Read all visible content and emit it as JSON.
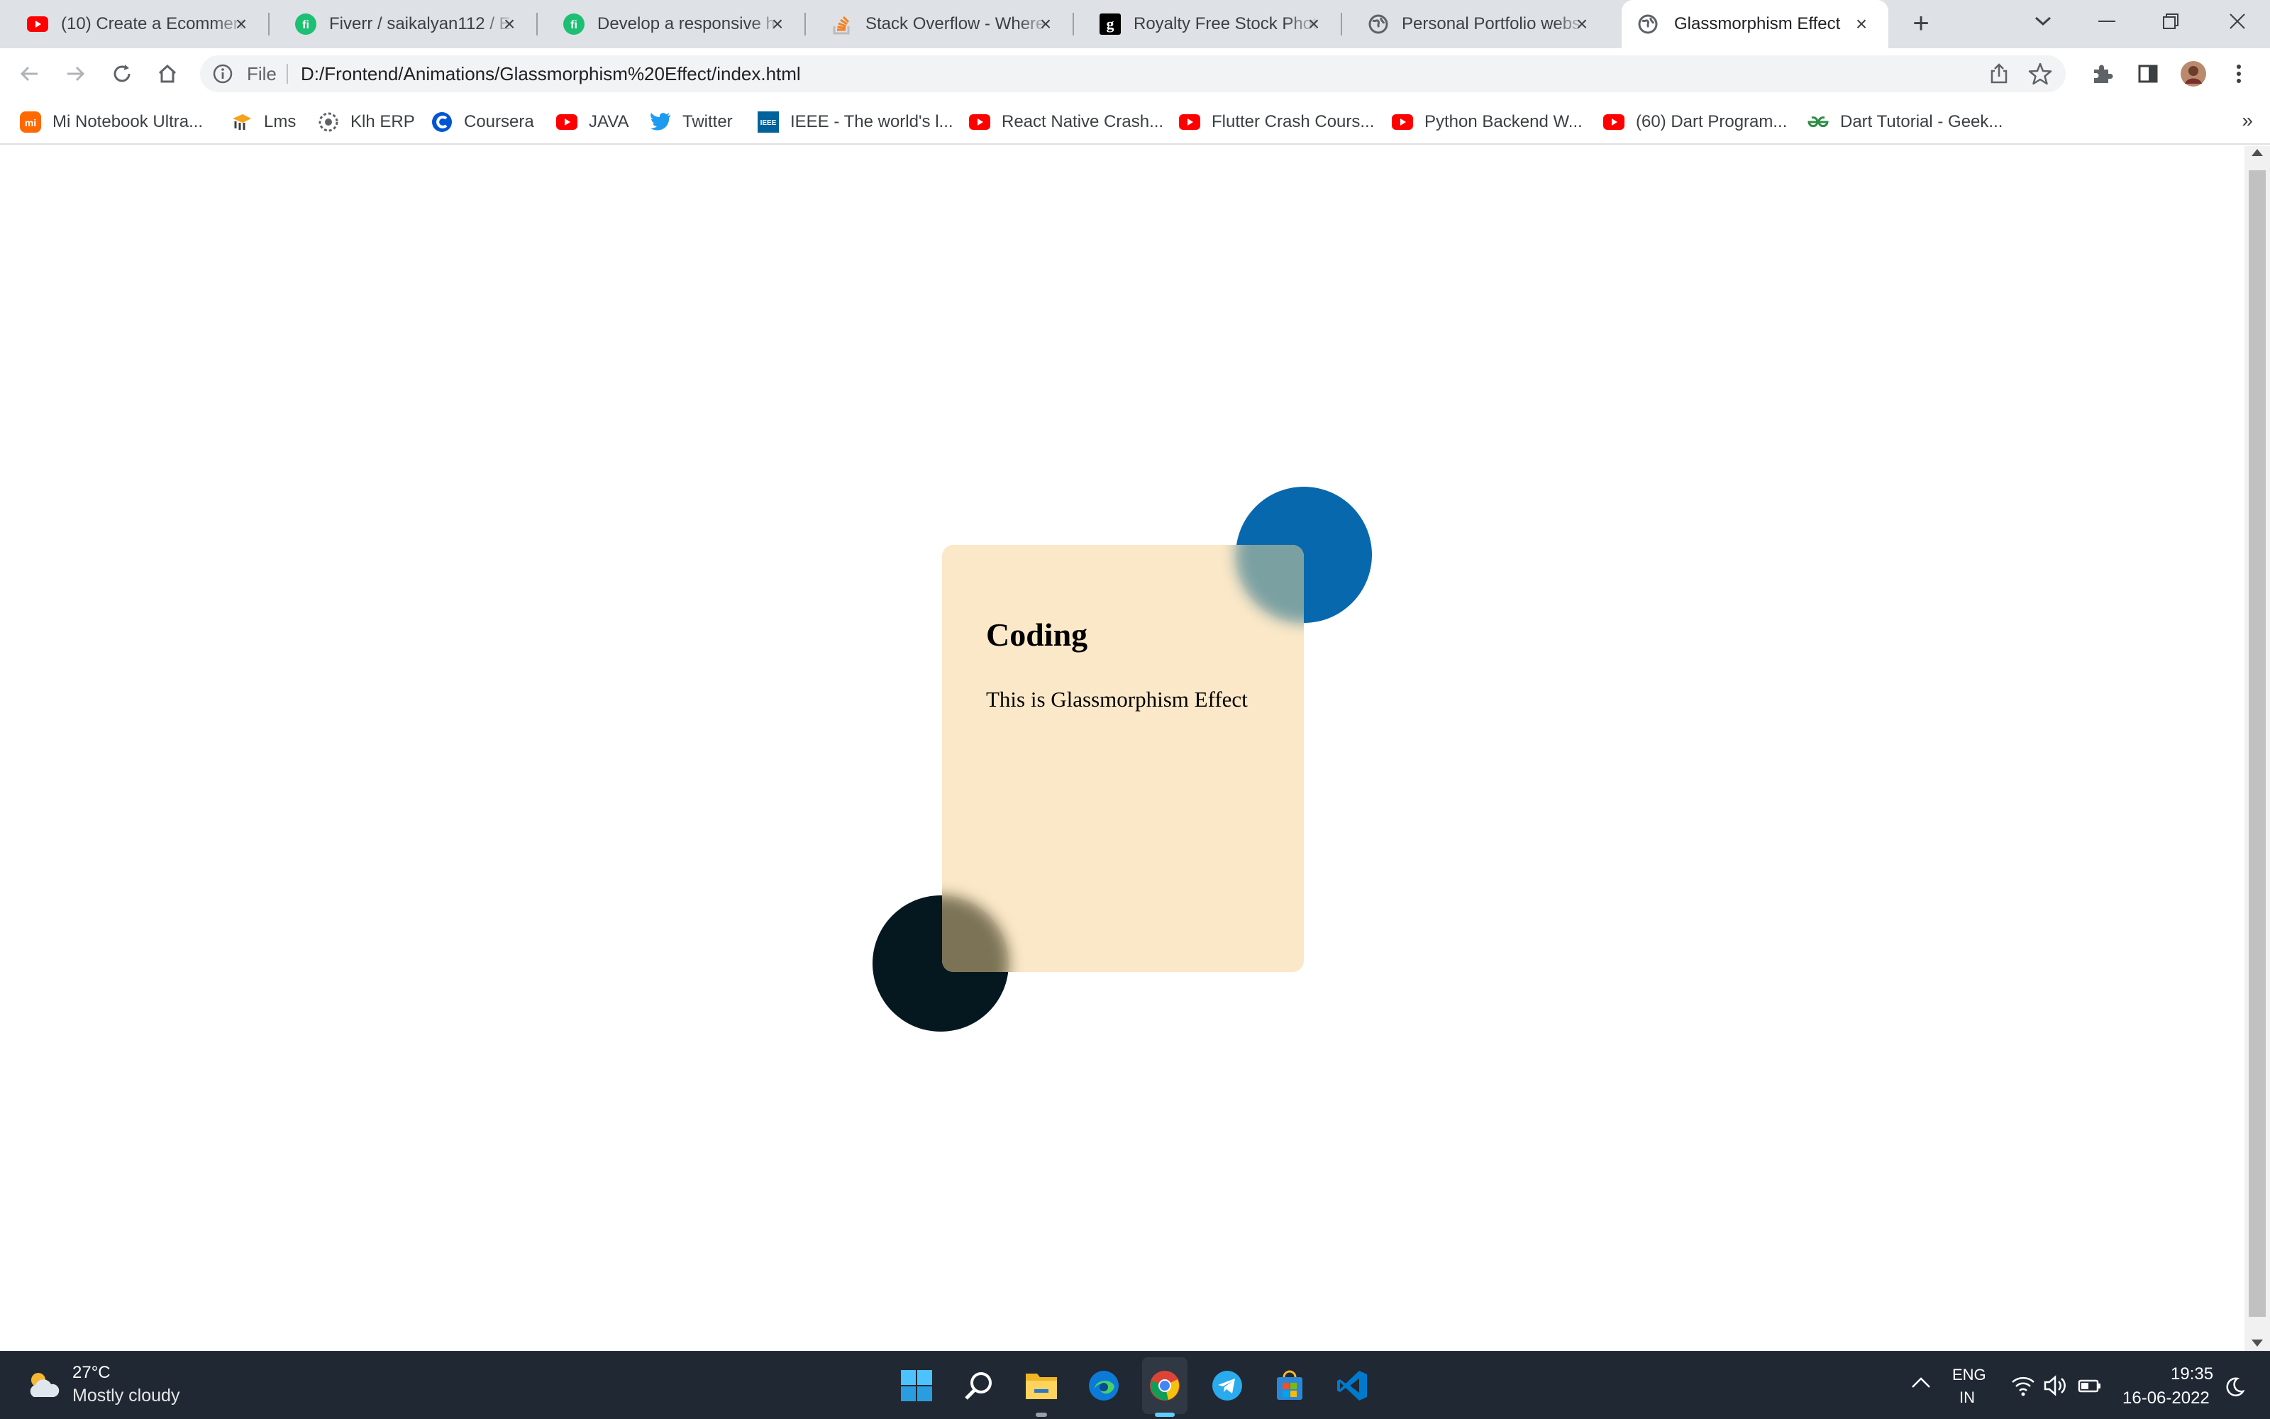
{
  "browser": {
    "tabs": [
      {
        "title": "(10) Create a Ecommerce",
        "favicon": "youtube-icon",
        "active": false
      },
      {
        "title": "Fiverr / saikalyan112 / E",
        "favicon": "fiverr-icon",
        "active": false
      },
      {
        "title": "Develop a responsive h",
        "favicon": "fiverr-icon",
        "active": false
      },
      {
        "title": "Stack Overflow - Where",
        "favicon": "stackoverflow-icon",
        "active": false
      },
      {
        "title": "Royalty Free Stock Phot",
        "favicon": "gettyimages-icon",
        "active": false
      },
      {
        "title": "Personal Portfolio webs",
        "favicon": "globe-icon",
        "active": false
      },
      {
        "title": "Glassmorphism Effect",
        "favicon": "globe-icon",
        "active": true
      }
    ],
    "address": {
      "scheme_label": "File",
      "url": "D:/Frontend/Animations/Glassmorphism%20Effect/index.html"
    },
    "bookmarks": [
      {
        "label": "Mi Notebook Ultra...",
        "icon": "mi-icon"
      },
      {
        "label": "Lms",
        "icon": "lms-icon"
      },
      {
        "label": "Klh ERP",
        "icon": "erp-icon"
      },
      {
        "label": "Coursera",
        "icon": "coursera-icon"
      },
      {
        "label": "JAVA",
        "icon": "youtube-icon"
      },
      {
        "label": "Twitter",
        "icon": "twitter-icon"
      },
      {
        "label": "IEEE - The world's l...",
        "icon": "ieee-icon"
      },
      {
        "label": "React Native Crash...",
        "icon": "youtube-icon"
      },
      {
        "label": "Flutter Crash Cours...",
        "icon": "youtube-icon"
      },
      {
        "label": "Python Backend W...",
        "icon": "youtube-icon"
      },
      {
        "label": "(60) Dart Program...",
        "icon": "youtube-icon"
      },
      {
        "label": "Dart Tutorial - Geek...",
        "icon": "geeksforgeeks-icon"
      }
    ],
    "bookmarks_overflow": "»"
  },
  "page": {
    "card": {
      "title": "Coding",
      "text": "This is Glassmorphism Effect"
    },
    "colors": {
      "card": "#fbe7c5",
      "blue_circle": "#0868ad",
      "dark_circle": "#05181f"
    }
  },
  "taskbar": {
    "weather": {
      "temp": "27°C",
      "desc": "Mostly cloudy"
    },
    "apps": [
      "windows-start-icon",
      "search-icon",
      "file-explorer-icon",
      "edge-icon",
      "chrome-icon",
      "telegram-icon",
      "microsoft-store-icon",
      "vscode-icon"
    ],
    "tray": {
      "lang1": "ENG",
      "lang2": "IN",
      "time": "19:35",
      "date": "16-06-2022"
    }
  }
}
